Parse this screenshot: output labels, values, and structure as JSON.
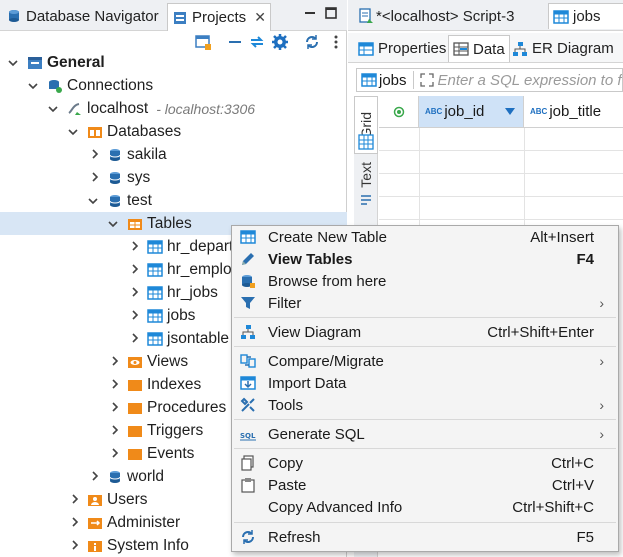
{
  "left_panel": {
    "tabs": [
      {
        "label": "Database Navigator"
      },
      {
        "label": "Projects",
        "close": "✕"
      }
    ],
    "tree": {
      "general": "General",
      "connections": "Connections",
      "localhost": "localhost",
      "localhost_addr": "- localhost:3306",
      "databases": "Databases",
      "sakila": "sakila",
      "sys": "sys",
      "test": "test",
      "tables": "Tables",
      "table_items": [
        "hr_depart",
        "hr_emplo",
        "hr_jobs",
        "jobs",
        "jsontable"
      ],
      "views": "Views",
      "indexes": "Indexes",
      "procedures": "Procedures",
      "triggers": "Triggers",
      "events": "Events",
      "world": "world",
      "users": "Users",
      "administer": "Administer",
      "system_info": "System Info"
    }
  },
  "right_panel": {
    "editor_tabs": [
      {
        "label": "*<localhost> Script-3"
      },
      {
        "label": "jobs"
      }
    ],
    "sub_tabs": [
      {
        "label": "Properties"
      },
      {
        "label": "Data"
      },
      {
        "label": "ER Diagram"
      }
    ],
    "filter": {
      "table_label": "jobs",
      "placeholder": "Enter a SQL expression to f"
    },
    "side_tabs": {
      "grid": "Grid",
      "text": "Text"
    },
    "columns": [
      {
        "type_badge": "ABC",
        "name": "job_id"
      },
      {
        "type_badge": "ABC",
        "name": "job_title"
      }
    ]
  },
  "context_menu": {
    "items": [
      {
        "label": "Create New Table",
        "shortcut": "Alt+Insert",
        "icon": "table-add-icon"
      },
      {
        "label": "View Tables",
        "shortcut": "F4",
        "icon": "pencil-icon",
        "bold": true
      },
      {
        "label": "Browse from here",
        "shortcut": "",
        "icon": "database-browse-icon"
      },
      {
        "label": "Filter",
        "shortcut": "",
        "icon": "filter-icon",
        "submenu": true
      },
      {
        "label": "View Diagram",
        "shortcut": "Ctrl+Shift+Enter",
        "icon": "diagram-icon"
      },
      {
        "label": "Compare/Migrate",
        "shortcut": "",
        "icon": "compare-icon",
        "submenu": true
      },
      {
        "label": "Import Data",
        "shortcut": "",
        "icon": "import-icon"
      },
      {
        "label": "Tools",
        "shortcut": "",
        "icon": "tools-icon",
        "submenu": true
      },
      {
        "label": "Generate SQL",
        "shortcut": "",
        "icon": "sql-icon",
        "submenu": true
      },
      {
        "label": "Copy",
        "shortcut": "Ctrl+C",
        "icon": "copy-icon"
      },
      {
        "label": "Paste",
        "shortcut": "Ctrl+V",
        "icon": "paste-icon"
      },
      {
        "label": "Copy Advanced Info",
        "shortcut": "Ctrl+Shift+C",
        "icon": ""
      },
      {
        "label": "Refresh",
        "shortcut": "F5",
        "icon": "refresh-icon"
      }
    ],
    "submenu_arrow": "›"
  },
  "colors": {
    "selection": "#d8e6f5",
    "header_selected": "#cfe2f7",
    "menu_bg": "#f4f4f4",
    "accent_blue": "#1e88d8",
    "folder_orange": "#f08a19",
    "db_blue": "#2a6fb0"
  }
}
